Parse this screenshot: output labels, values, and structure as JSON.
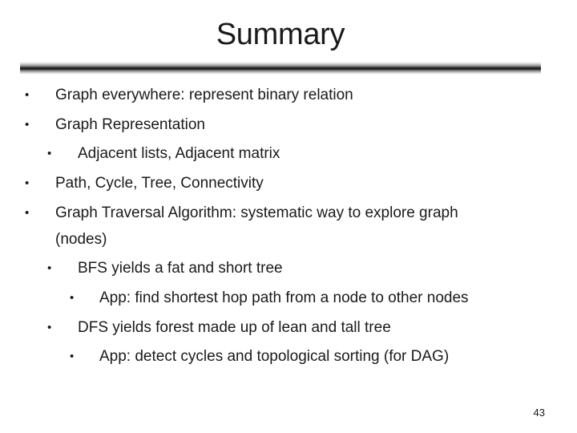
{
  "slide": {
    "title": "Summary",
    "bullet_glyph": "•",
    "items": [
      {
        "level": 1,
        "text": "Graph everywhere: represent binary relation"
      },
      {
        "level": 1,
        "text": "Graph Representation"
      },
      {
        "level": 2,
        "text": "Adjacent lists, Adjacent matrix"
      },
      {
        "level": 1,
        "text": "Path, Cycle, Tree, Connectivity"
      },
      {
        "level": 1,
        "text": "Graph Traversal Algorithm: systematic way to explore graph"
      },
      {
        "level": 1,
        "text": "(nodes)",
        "continuation": true
      },
      {
        "level": 2,
        "text": "BFS yields a fat and short tree"
      },
      {
        "level": 3,
        "text": "App: find shortest hop path from a node to other nodes"
      },
      {
        "level": 2,
        "text": "DFS yields forest made up of lean and tall tree"
      },
      {
        "level": 3,
        "text": "App: detect cycles and topological sorting (for DAG)"
      }
    ],
    "page_number": "43"
  }
}
